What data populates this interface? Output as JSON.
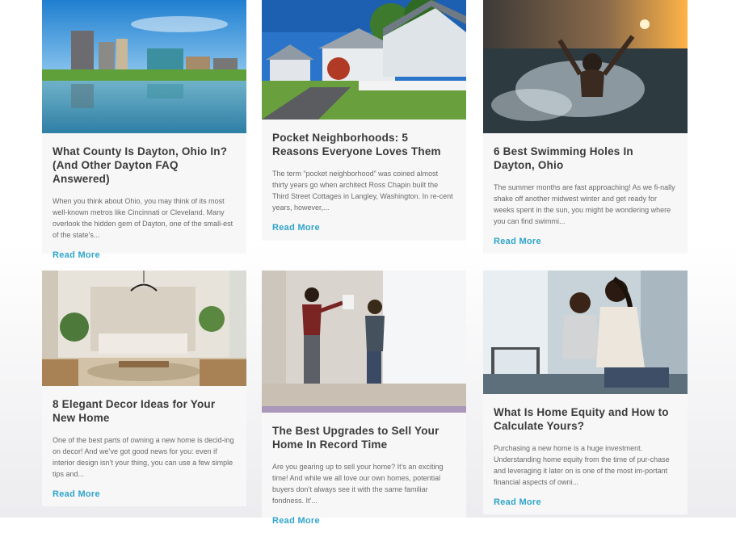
{
  "accent_color": "#2fa4c9",
  "posts": [
    {
      "title": "What County Is Dayton, Ohio In? (And Other Dayton FAQ Answered)",
      "excerpt": "When you think about Ohio, you may think of its most well-known metros like Cincinnati or Cleveland. Many overlook the hidden gem of Dayton, one of the small-est of the state’s...",
      "link": "Read More",
      "image": "dayton-skyline-image"
    },
    {
      "title": "Pocket Neighborhoods: 5 Reasons Everyone Loves Them",
      "excerpt": "The term “pocket neighborhood” was coined almost thirty years go when architect Ross Chapin built the Third Street Cottages in Langley, Washington. In re-cent years, however,...",
      "link": "Read More",
      "image": "suburban-houses-image"
    },
    {
      "title": "6 Best Swimming Holes In Dayton, Ohio",
      "excerpt": "The summer months are fast approaching! As we fi-nally shake off another midwest winter and get ready for weeks spent in the sun, you might be wondering where you can find swimmi...",
      "link": "Read More",
      "image": "swimming-splash-image"
    },
    {
      "title": "8 Elegant Decor Ideas for Your New Home",
      "excerpt": "One of the best parts of owning a new home is decid-ing on decor! And we’ve got good news for you: even if interior design isn’t your thing, you can use a few simple tips and...",
      "link": "Read More",
      "image": "living-room-image"
    },
    {
      "title": "The Best Upgrades to Sell Your Home In Record Time",
      "excerpt": "Are you gearing up to sell your home? It’s an exciting time! And while we all love our own homes, potential buyers don’t always see it with the same familiar fondness. It’...",
      "link": "Read More",
      "image": "couple-painting-image"
    },
    {
      "title": "What Is Home Equity and How to Calculate Yours?",
      "excerpt": "Purchasing a new home is a huge investment. Understanding home equity from the time of pur-chase and leveraging it later on is one of the most im-portant financial aspects of owni...",
      "link": "Read More",
      "image": "couple-laptop-image"
    }
  ]
}
